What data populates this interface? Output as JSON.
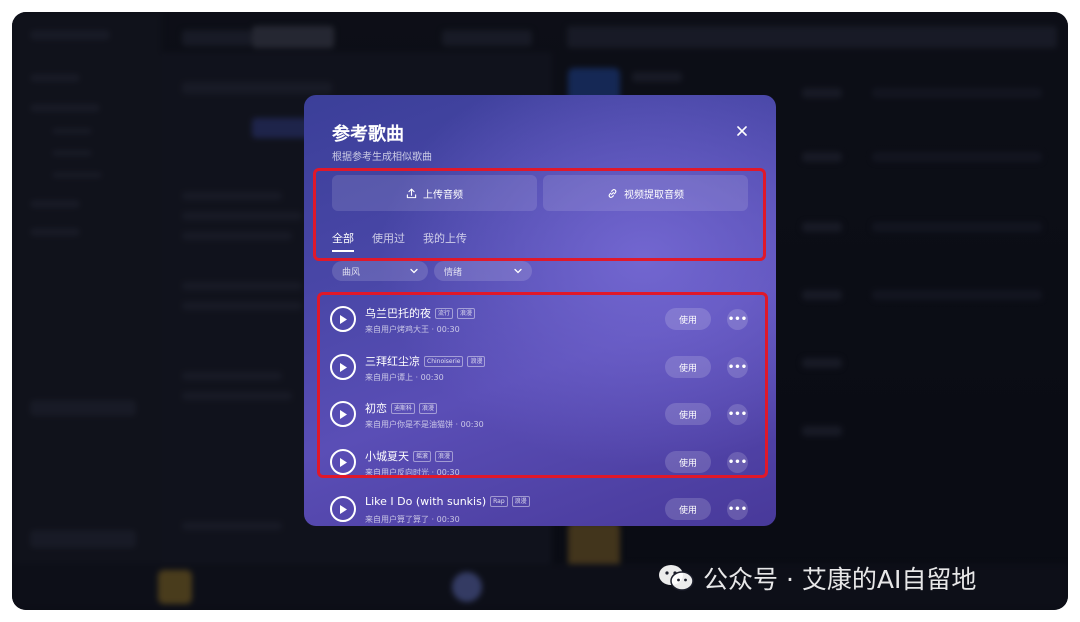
{
  "modal": {
    "title": "参考歌曲",
    "subtitle": "根据参考生成相似歌曲",
    "upload_label": "上传音频",
    "extract_label": "视频提取音频",
    "tabs": [
      {
        "label": "全部",
        "active": true
      },
      {
        "label": "使用过",
        "active": false
      },
      {
        "label": "我的上传",
        "active": false
      }
    ],
    "filters": [
      {
        "label": "曲风"
      },
      {
        "label": "情绪"
      }
    ],
    "songs": [
      {
        "title": "乌兰巴托的夜",
        "tags": [
          "流行",
          "浪漫"
        ],
        "meta": "来自用户烤鸡大王 · 00:30",
        "use_label": "使用"
      },
      {
        "title": "三拜红尘凉",
        "tags": [
          "Chinoiserie",
          "浪漫"
        ],
        "meta": "来自用户谭上 · 00:30",
        "use_label": "使用"
      },
      {
        "title": "初恋",
        "tags": [
          "迪斯科",
          "浪漫"
        ],
        "meta": "来自用户你是不是油猫饼 · 00:30",
        "use_label": "使用"
      },
      {
        "title": "小城夏天",
        "tags": [
          "摇滚",
          "浪漫"
        ],
        "meta": "来自用户反向时光 · 00:30",
        "use_label": "使用"
      },
      {
        "title": "Like I Do (with sunkis)",
        "tags": [
          "Rap",
          "浪漫"
        ],
        "meta": "来自用户算了算了 · 00:30",
        "use_label": "使用"
      }
    ]
  },
  "watermark": {
    "text": "公众号 · 艾康的AI自留地"
  },
  "colors": {
    "highlight": "#e0182a",
    "modal_start": "#3b3f99",
    "modal_end": "#5a4eb6"
  },
  "icons": {
    "close": "close-icon",
    "upload": "upload-icon",
    "link": "link-icon",
    "play": "play-icon",
    "more": "more-icon",
    "chevron": "chevron-down-icon"
  }
}
